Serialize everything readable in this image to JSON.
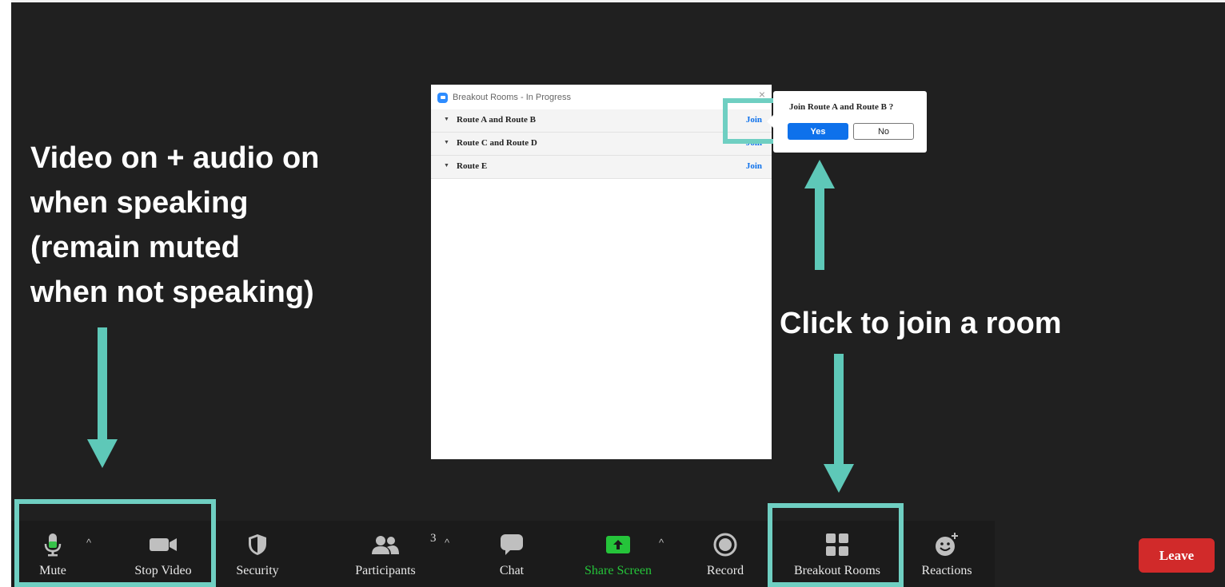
{
  "annotations": {
    "left_callout": [
      "Video on + audio on",
      "when speaking",
      "(remain muted",
      "when not speaking)"
    ],
    "right_callout": "Click to join a room",
    "accent_color": "#5ec8b8"
  },
  "breakout_window": {
    "title": "Breakout Rooms - In Progress",
    "close": "×",
    "rooms": [
      {
        "name": "Route A and Route B",
        "action": "Join"
      },
      {
        "name": "Route C and Route D",
        "action": "Join"
      },
      {
        "name": "Route E",
        "action": "Join"
      }
    ]
  },
  "join_popover": {
    "question": "Join Route A and Route B ?",
    "yes_label": "Yes",
    "no_label": "No"
  },
  "toolbar": {
    "mute_label": "Mute",
    "stop_video_label": "Stop Video",
    "security_label": "Security",
    "participants_label": "Participants",
    "participants_count": "3",
    "chat_label": "Chat",
    "share_screen_label": "Share Screen",
    "record_label": "Record",
    "breakout_rooms_label": "Breakout Rooms",
    "reactions_label": "Reactions",
    "leave_label": "Leave",
    "caret": "^"
  }
}
